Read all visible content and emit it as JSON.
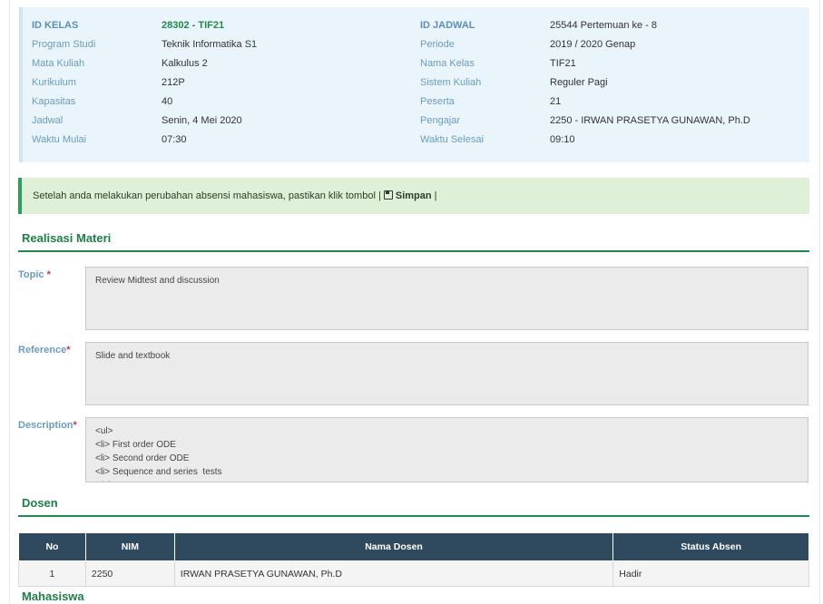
{
  "info": {
    "left": [
      {
        "label": "ID KELAS",
        "value": "28302 - TIF21"
      },
      {
        "label": "Program Studi",
        "value": "Teknik Informatika S1"
      },
      {
        "label": "Mata Kuliah",
        "value": "Kalkulus 2"
      },
      {
        "label": "Kurikulum",
        "value": "212P"
      },
      {
        "label": "Kapasitas",
        "value": "40"
      },
      {
        "label": "Jadwal",
        "value": "Senin, 4 Mei 2020"
      },
      {
        "label": "Waktu Mulai",
        "value": "07:30"
      }
    ],
    "right": [
      {
        "label": "ID JADWAL",
        "value": "25544 Pertemuan ke - 8"
      },
      {
        "label": "Periode",
        "value": "2019 / 2020 Genap"
      },
      {
        "label": "Nama Kelas",
        "value": "TIF21"
      },
      {
        "label": "Sistem Kuliah",
        "value": "Reguler Pagi"
      },
      {
        "label": "Peserta",
        "value": "21"
      },
      {
        "label": "Pengajar",
        "value": "2250 - IRWAN PRASETYA GUNAWAN, Ph.D"
      },
      {
        "label": "Waktu Selesai",
        "value": "09:10"
      }
    ]
  },
  "alert": {
    "text": "Setelah anda melakukan perubahan absensi mahasiswa, pastikan klik tombol |",
    "save_label": "Simpan",
    "suffix": "|"
  },
  "realisasi": {
    "title": "Realisasi Materi",
    "topic_label": "Topic",
    "topic_value": "Review Midtest and discussion",
    "reference_label": "Reference",
    "reference_value": "Slide and textbook",
    "description_label": "Description",
    "description_value": "<ul>\n<li> First order ODE\n<li> Second order ODE\n<li> Sequence and series  tests\n</ul>",
    "required_mark": "*"
  },
  "dosen": {
    "title": "Dosen",
    "headers": [
      "No",
      "NIM",
      "Nama Dosen",
      "Status Absen"
    ],
    "rows": [
      {
        "no": "1",
        "nim": "2250",
        "nama": "IRWAN PRASETYA GUNAWAN, Ph.D",
        "status": "Hadir"
      }
    ]
  },
  "mahasiswa": {
    "title": "Mahasiswa"
  },
  "colors": {
    "accent_green": "#1e8a4c",
    "label_blue": "#6a9dbd",
    "table_header": "#2f4a5e",
    "alert_bg": "#dff0d8",
    "info_bg": "#eaf4fb"
  }
}
